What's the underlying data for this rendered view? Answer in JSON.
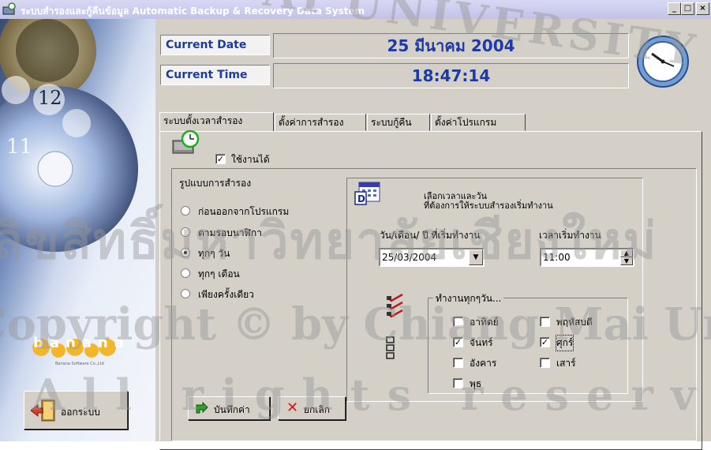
{
  "window": {
    "title": "ระบบสำรองและกู้คืนข้อมูล  Automatic Backup & Recovery Data System",
    "minimize": "_",
    "maximize": "□",
    "close": "×"
  },
  "header": {
    "current_date_label": "Current Date",
    "current_date_value": "25 มีนาคม 2004",
    "current_time_label": "Current Time",
    "current_time_value": "18:47:14",
    "accent_color": "#1b3aa8"
  },
  "sidebar": {
    "exit_button": "ออกระบบ",
    "logo_text": "banana",
    "logo_sub": "Banana Software Co.,Ltd"
  },
  "tabs": [
    {
      "label": "ระบบตั้งเวลาสำรอง",
      "active": true
    },
    {
      "label": "ตั้งค่าการสำรอง",
      "active": false
    },
    {
      "label": "ระบบกู้คืน",
      "active": false
    },
    {
      "label": "ตั้งค่าโปรแกรม",
      "active": false
    }
  ],
  "schedule": {
    "enable_label": "ใช้งานได้",
    "enabled": true,
    "backup_mode_title": "รูปแบบการสำรอง",
    "modes": [
      {
        "label": "ก่อนออกจากโปรแกรม",
        "selected": false
      },
      {
        "label": "ตามรอบนาฬิกา",
        "selected": false
      },
      {
        "label": "ทุกๆ วัน",
        "selected": true
      },
      {
        "label": "ทุกๆ เดือน",
        "selected": false
      },
      {
        "label": "เพียงครั้งเดียว",
        "selected": false
      }
    ],
    "select_time_line1": "เลือกเวลาและวัน",
    "select_time_line2": "ที่ต้องการให้ระบบสำรองเริ่มทำงาน",
    "start_date_label": "วัน/เดือน/ ปี ที่เริ่มทำงาน",
    "start_date_value": "25/03/2004",
    "start_time_label": "เวลาเริ่มทำงาน",
    "start_time_value": "11:00",
    "days_group_title": "ทำงานทุกๆวัน...",
    "days": [
      {
        "label": "อาทิตย์",
        "checked": false
      },
      {
        "label": "จันทร์",
        "checked": true
      },
      {
        "label": "อังคาร",
        "checked": false
      },
      {
        "label": "พุธ",
        "checked": false
      },
      {
        "label": "พฤหัสบดี",
        "checked": false
      },
      {
        "label": "ศุกร์",
        "checked": true
      },
      {
        "label": "เสาร์",
        "checked": false
      }
    ],
    "save_button": "บันทึกค่า",
    "cancel_button": "ยกเลิก"
  },
  "watermark": {
    "line1": "ลิขสิทธิ์มหาวิทยาลัยเชียงใหม่",
    "line2": "Copyright © by Chiang Mai University",
    "line3": "All rights reserved",
    "arc": "AI UNIVERSITY"
  }
}
